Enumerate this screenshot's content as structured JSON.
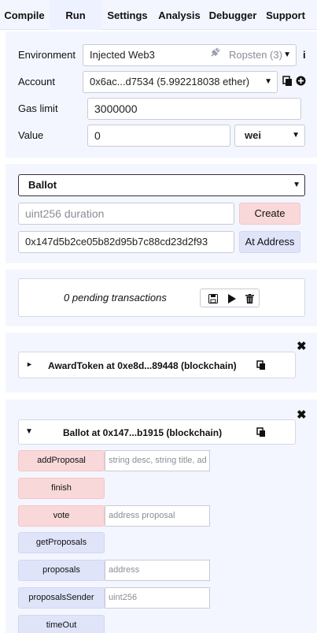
{
  "tabs": [
    "Compile",
    "Run",
    "Settings",
    "Analysis",
    "Debugger",
    "Support"
  ],
  "environment": {
    "label": "Environment",
    "value": "Injected Web3",
    "network": "Ropsten (3)",
    "info": "i"
  },
  "account": {
    "label": "Account",
    "value": "0x6ac...d7534 (5.992218038 ether)"
  },
  "gas_limit": {
    "label": "Gas limit",
    "value": "3000000"
  },
  "value": {
    "label": "Value",
    "amount": "0",
    "unit": "wei"
  },
  "contract": {
    "selected": "Ballot",
    "duration_placeholder": "uint256 duration",
    "create_label": "Create",
    "address_value": "0x147d5b2ce05b82d95b7c88cd23d2f93",
    "at_address_label": "At Address"
  },
  "pending": {
    "text": "0 pending transactions"
  },
  "instances": [
    {
      "toggle": "►",
      "title": "AwardToken at 0xe8d...89448 (blockchain)"
    },
    {
      "toggle": "▼",
      "title": "Ballot at 0x147...b1915 (blockchain)"
    }
  ],
  "functions": [
    {
      "name": "addProposal",
      "placeholder": "string desc, string title, ad"
    },
    {
      "name": "finish",
      "placeholder": ""
    },
    {
      "name": "vote",
      "placeholder": "address proposal"
    },
    {
      "name": "getProposals",
      "placeholder": ""
    },
    {
      "name": "proposals",
      "placeholder": "address"
    },
    {
      "name": "proposalsSender",
      "placeholder": "uint256"
    },
    {
      "name": "timeOut",
      "placeholder": ""
    }
  ],
  "colors": {
    "transact": "#f9d8d9",
    "call": "#dfe4f9",
    "panel": "#f4f6ff"
  }
}
